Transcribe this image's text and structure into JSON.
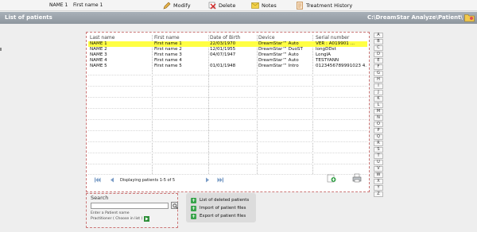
{
  "toolbar": {
    "last_name": "NAME 1",
    "first_name": "First name 1",
    "modify": "Modify",
    "delete": "Delete",
    "notes": "Notes",
    "treatment_history": "Treatment History"
  },
  "titlebar": {
    "title": "List of patients",
    "path": "C:\\DreamStar Analyze\\Patient\\"
  },
  "table": {
    "columns": [
      "Last name",
      "First name",
      "Date of Birth",
      "Device",
      "Serial number"
    ],
    "rows": [
      [
        "NAME 1",
        "First name 1",
        "22/03/1970",
        "DreamStar™ Auto",
        "VER : A019901  ..."
      ],
      [
        "NAME 2",
        "First name 2",
        "12/01/1955",
        "DreamStar™ DuoST",
        "longDDst"
      ],
      [
        "NAME 3",
        "First name 3",
        "04/07/1947",
        "DreamStar™ Auto",
        "LongIA"
      ],
      [
        "NAME 4",
        "First name 4",
        "",
        "DreamStar™ Auto",
        "TESTYANN"
      ],
      [
        "NAME 5",
        "First name 5",
        "01/01/1948",
        "DreamStar™ Intro",
        "0123456789991023 4..."
      ]
    ],
    "selected_row": 0,
    "pager_text": "Displaying patients 1-5 of 5"
  },
  "alphabet": [
    "A",
    "B",
    "C",
    "D",
    "E",
    "F",
    "G",
    "H",
    "I",
    "J",
    "K",
    "L",
    "M",
    "N",
    "O",
    "P",
    "Q",
    "R",
    "S",
    "T",
    "U",
    "V",
    "W",
    "X",
    "Y",
    "Z"
  ],
  "search": {
    "label": "Search",
    "hint": "Enter a Patient name",
    "practitioner": "Practitioner ( Choose in list ) :"
  },
  "actions": {
    "deleted": "List of deleted patients",
    "import": "Import of patient files",
    "export": "Export of patient files"
  },
  "colors": {
    "selection": "#ffff44",
    "titlebar": "#9aa2aa",
    "frame_border": "#cc7777",
    "action_green": "#37a34a"
  }
}
